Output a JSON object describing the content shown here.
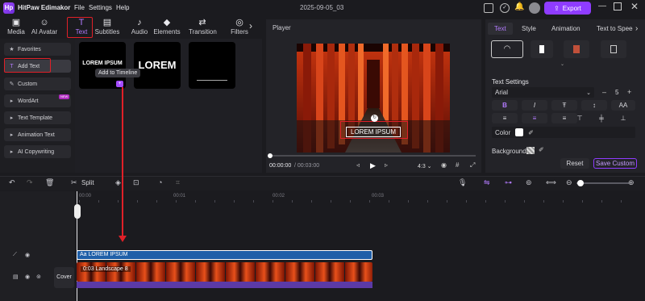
{
  "app": {
    "title": "HitPaw Edimakor",
    "logo_glyph": "Hp",
    "date": "2025-09-05_03"
  },
  "menu": [
    "File",
    "Settings",
    "Help"
  ],
  "export_label": "Export",
  "toolbar": [
    {
      "label": "Media",
      "icon": "media-icon",
      "glyph": "▣"
    },
    {
      "label": "AI Avatar",
      "icon": "avatar-icon",
      "glyph": "☺"
    },
    {
      "label": "Text",
      "icon": "text-icon",
      "glyph": "T"
    },
    {
      "label": "Subtitles",
      "icon": "subtitles-icon",
      "glyph": "▤"
    },
    {
      "label": "Audio",
      "icon": "audio-icon",
      "glyph": "♪"
    },
    {
      "label": "Elements",
      "icon": "elements-icon",
      "glyph": "◆"
    },
    {
      "label": "Transition",
      "icon": "transition-icon",
      "glyph": "⇄"
    },
    {
      "label": "Filters",
      "icon": "filters-icon",
      "glyph": "◎"
    }
  ],
  "sidebar": [
    {
      "label": "Favorites",
      "glyph": "★"
    },
    {
      "label": "Add Text",
      "glyph": "T"
    },
    {
      "label": "Custom",
      "glyph": "✎"
    },
    {
      "label": "WordArt",
      "glyph": "▸",
      "badge": "NEW"
    },
    {
      "label": "Text Template",
      "glyph": "▸"
    },
    {
      "label": "Animation Text",
      "glyph": "▸"
    },
    {
      "label": "AI Copywriting",
      "glyph": "▸"
    }
  ],
  "library": {
    "thumb1_text": "LOREM IPSUM",
    "thumb2_text": "LOREM",
    "tooltip": "Add to Timeline"
  },
  "player": {
    "title": "Player",
    "overlay_text": "LOREM IPSUM",
    "time_current": "00:00:00",
    "time_total": "/ 00:03:00",
    "ratio": "4:3 ⌄"
  },
  "right": {
    "tabs": [
      "Text",
      "Style",
      "Animation",
      "Text to Speech"
    ],
    "settings_title": "Text Settings",
    "font": "Arial",
    "font_size": "5",
    "color_label": "Color",
    "background_label": "Background",
    "reset_label": "Reset",
    "save_custom_label": "Save Custom"
  },
  "timeline": {
    "split_label": "Split",
    "ticks": [
      "00:00",
      "00:01",
      "00:02",
      "00:03"
    ],
    "text_clip": "Aa LOREM IPSUM",
    "video_clip": "0:03 Landscape 8",
    "cover_label": "Cover"
  },
  "colors": {
    "accent": "#8f3cff",
    "highlight": "#e02028",
    "text_clip": "#1f5fa8",
    "audio_bar": "#5b3aa6"
  }
}
